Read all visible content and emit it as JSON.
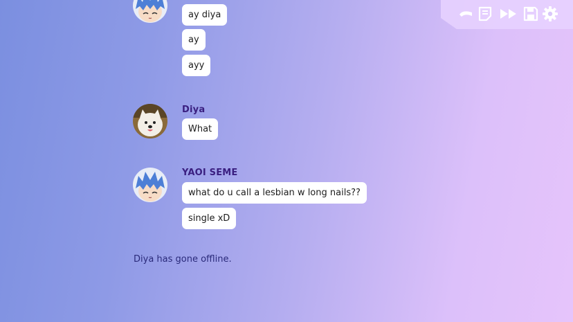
{
  "toolbar": {
    "buttons": [
      {
        "icon": "back-icon"
      },
      {
        "icon": "log-icon"
      },
      {
        "icon": "skip-icon"
      },
      {
        "icon": "save-icon"
      },
      {
        "icon": "settings-icon"
      }
    ],
    "icon_color": "#ffffff"
  },
  "chat": {
    "group1": {
      "messages": [
        "ay diya",
        "ay",
        "ayy"
      ]
    },
    "group2": {
      "sender": "Diya",
      "messages": [
        "What"
      ]
    },
    "group3": {
      "sender": "YAOI SEME",
      "messages": [
        "what do u call a lesbian w long nails??",
        "single xD"
      ]
    },
    "system_message": "Diya has gone offline."
  },
  "colors": {
    "name": "#3a1f80",
    "bubble": "#ffffff",
    "system_text": "#2a2a7a"
  }
}
